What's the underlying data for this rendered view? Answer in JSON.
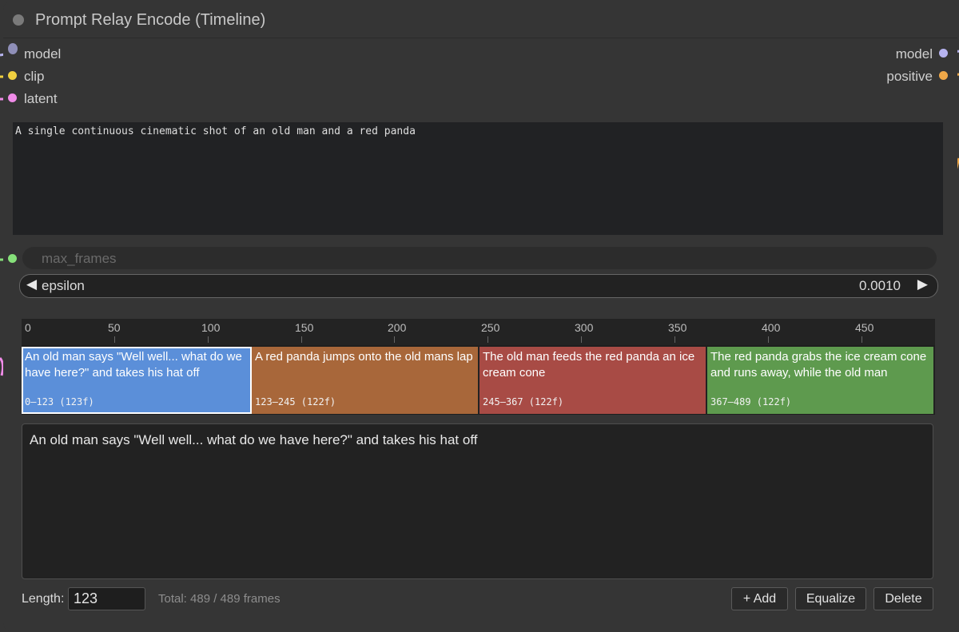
{
  "node": {
    "title": "Prompt Relay Encode (Timeline)",
    "inputs": [
      {
        "label": "model",
        "color": "#8f8fb8"
      },
      {
        "label": "clip",
        "color": "#f0d040"
      },
      {
        "label": "latent",
        "color": "#f08be8"
      }
    ],
    "outputs": [
      {
        "label": "model",
        "color": "#b7b4f0"
      },
      {
        "label": "positive",
        "color": "#f0a848"
      }
    ],
    "int_input_color": "#86e07a"
  },
  "prompt": {
    "text": "A single continuous cinematic shot of an old man and a red panda"
  },
  "max_frames": {
    "label": "max_frames"
  },
  "epsilon": {
    "label": "epsilon",
    "value": "0.0010",
    "left_arrow": "◀",
    "right_arrow": "▶"
  },
  "timeline": {
    "total_frames": 489,
    "ruler_ticks": [
      "0",
      "50",
      "100",
      "150",
      "200",
      "250",
      "300",
      "350",
      "400",
      "450"
    ],
    "segments": [
      {
        "text": "An old man says \"Well well... what do we have here?\" and takes his hat off",
        "range": "0–123 (123f)",
        "start": 0,
        "end": 123,
        "color": "#5b8fd9",
        "selected": true
      },
      {
        "text": "A red panda jumps onto the old mans lap",
        "range": "123–245 (122f)",
        "start": 123,
        "end": 245,
        "color": "#a8673a",
        "selected": false
      },
      {
        "text": "The old man feeds the red panda an ice cream cone",
        "range": "245–367 (122f)",
        "start": 245,
        "end": 367,
        "color": "#a84b45",
        "selected": false
      },
      {
        "text": "The red panda grabs the ice cream cone and runs away, while the old man",
        "range": "367–489 (122f)",
        "start": 367,
        "end": 489,
        "color": "#5e9a4e",
        "selected": false
      }
    ]
  },
  "editor": {
    "text": "An old man says \"Well well... what do we have here?\" and takes his hat off",
    "length_label": "Length:",
    "length_value": "123",
    "total_text": "Total: 489 / 489 frames",
    "add_label": "+ Add",
    "equalize_label": "Equalize",
    "delete_label": "Delete"
  }
}
